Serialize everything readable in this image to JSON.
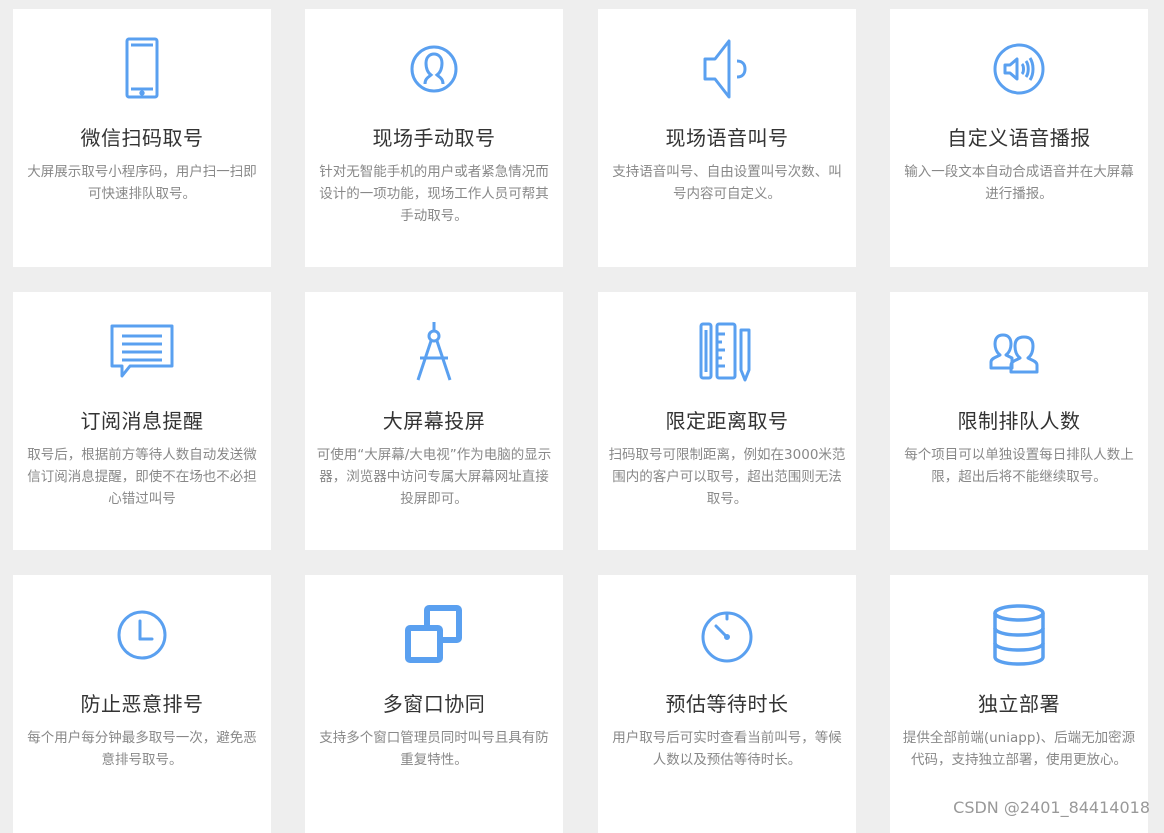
{
  "colors": {
    "accent": "#5aa0f0",
    "background": "#eeeeee",
    "card": "#ffffff",
    "title": "#333333",
    "text": "#888888"
  },
  "features": [
    {
      "icon": "smartphone-icon",
      "title": "微信扫码取号",
      "desc": "大屏展示取号小程序码，用户扫一扫即可快速排队取号。"
    },
    {
      "icon": "user-circle-icon",
      "title": "现场手动取号",
      "desc": "针对无智能手机的用户或者紧急情况而设计的一项功能，现场工作人员可帮其手动取号。"
    },
    {
      "icon": "speaker-icon",
      "title": "现场语音叫号",
      "desc": "支持语音叫号、自由设置叫号次数、叫号内容可自定义。"
    },
    {
      "icon": "volume-circle-icon",
      "title": "自定义语音播报",
      "desc": "输入一段文本自动合成语音并在大屏幕进行播报。"
    },
    {
      "icon": "message-icon",
      "title": "订阅消息提醒",
      "desc": "取号后，根据前方等待人数自动发送微信订阅消息提醒，即使不在场也不必担心错过叫号"
    },
    {
      "icon": "compass-icon",
      "title": "大屏幕投屏",
      "desc": "可使用“大屏幕/大电视”作为电脑的显示器，浏览器中访问专属大屏幕网址直接投屏即可。"
    },
    {
      "icon": "ruler-pencil-icon",
      "title": "限定距离取号",
      "desc": "扫码取号可限制距离，例如在3000米范围内的客户可以取号，超出范围则无法取号。"
    },
    {
      "icon": "users-icon",
      "title": "限制排队人数",
      "desc": "每个项目可以单独设置每日排队人数上限，超出后将不能继续取号。"
    },
    {
      "icon": "clock-icon",
      "title": "防止恶意排号",
      "desc": "每个用户每分钟最多取号一次，避免恶意排号取号。"
    },
    {
      "icon": "windows-icon",
      "title": "多窗口协同",
      "desc": "支持多个窗口管理员同时叫号且具有防重复特性。"
    },
    {
      "icon": "timer-icon",
      "title": "预估等待时长",
      "desc": "用户取号后可实时查看当前叫号，等候人数以及预估等待时长。"
    },
    {
      "icon": "database-icon",
      "title": "独立部署",
      "desc": "提供全部前端(uniapp)、后端无加密源代码，支持独立部署，使用更放心。"
    }
  ],
  "watermark": "CSDN @2401_84414018"
}
